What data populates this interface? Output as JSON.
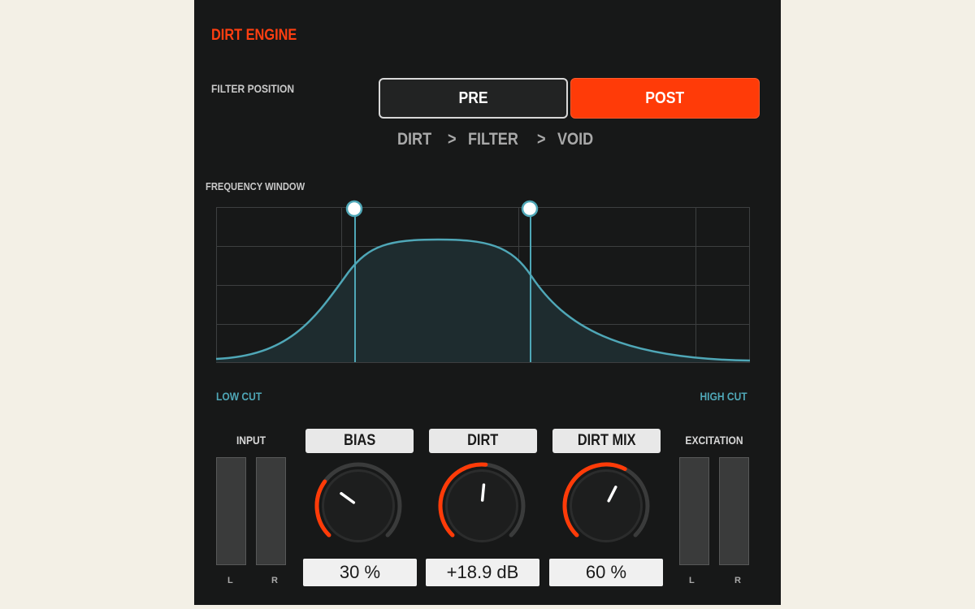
{
  "app": {
    "title": "DIRT ENGINE"
  },
  "filter_position": {
    "label": "FILTER POSITION",
    "options": [
      "PRE",
      "POST"
    ],
    "selected": "POST"
  },
  "signal_chain": [
    "DIRT",
    ">",
    "FILTER",
    ">",
    "VOID"
  ],
  "frequency_window": {
    "label": "FREQUENCY WINDOW",
    "low_cut_label": "LOW CUT",
    "high_cut_label": "HIGH CUT"
  },
  "meters": {
    "input": {
      "title": "INPUT",
      "left": "L",
      "right": "R"
    },
    "excitation": {
      "title": "EXCITATION",
      "left": "L",
      "right": "R"
    }
  },
  "knobs": [
    {
      "title": "BIAS",
      "value": "30 %",
      "fraction": 0.3
    },
    {
      "title": "DIRT",
      "value": "+18.9 dB",
      "fraction": 0.52
    },
    {
      "title": "DIRT MIX",
      "value": "60 %",
      "fraction": 0.6
    }
  ],
  "colors": {
    "accent": "#ff3f11",
    "curve": "#4fa7b7",
    "panel": "#171818"
  }
}
